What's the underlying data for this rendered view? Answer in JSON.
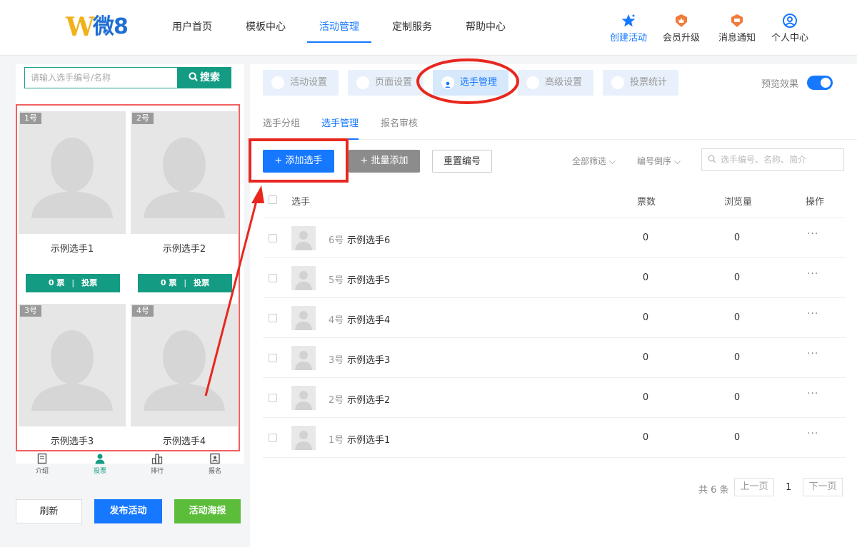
{
  "header": {
    "logo": {
      "letter": "W",
      "text": "微8"
    },
    "nav": [
      {
        "label": "用户首页"
      },
      {
        "label": "模板中心"
      },
      {
        "label": "活动管理",
        "active": true
      },
      {
        "label": "定制服务"
      },
      {
        "label": "帮助中心"
      }
    ],
    "tools": [
      {
        "label": "创建活动",
        "icon": "star-icon",
        "color": "#1677ff"
      },
      {
        "label": "会员升级",
        "icon": "crown-badge-icon",
        "color": "#f07c3a"
      },
      {
        "label": "消息通知",
        "icon": "message-badge-icon",
        "color": "#f07c3a"
      },
      {
        "label": "个人中心",
        "icon": "user-circle-icon",
        "color": "#1677ff"
      }
    ]
  },
  "preview": {
    "search": {
      "placeholder": "请输入选手编号/名称",
      "button": "搜索"
    },
    "contestants": [
      {
        "number": "1号",
        "name": "示例选手1",
        "votes": "0 票",
        "vote_label": "投票"
      },
      {
        "number": "2号",
        "name": "示例选手2",
        "votes": "0 票",
        "vote_label": "投票"
      },
      {
        "number": "3号",
        "name": "示例选手3"
      },
      {
        "number": "4号",
        "name": "示例选手4"
      }
    ],
    "tabbar": [
      {
        "label": "介绍",
        "icon": "document-icon"
      },
      {
        "label": "投票",
        "icon": "person-icon",
        "active": true
      },
      {
        "label": "排行",
        "icon": "bar-chart-icon"
      },
      {
        "label": "报名",
        "icon": "signup-icon"
      }
    ],
    "buttons": {
      "refresh": "刷新",
      "publish": "发布活动",
      "poster": "活动海报"
    }
  },
  "steps": [
    {
      "label": "活动设置",
      "icon": "shield-icon"
    },
    {
      "label": "页面设置",
      "icon": "page-icon"
    },
    {
      "label": "选手管理",
      "icon": "user-icon",
      "active": true
    },
    {
      "label": "高级设置",
      "icon": "sliders-icon"
    },
    {
      "label": "投票统计",
      "icon": "list-icon"
    }
  ],
  "preview_toggle": {
    "label": "预览效果",
    "on": true
  },
  "subtabs": [
    {
      "label": "选手分组"
    },
    {
      "label": "选手管理",
      "active": true
    },
    {
      "label": "报名审核"
    }
  ],
  "actions": {
    "add": "+ 添加选手",
    "batch": "+ 批量添加",
    "reset": "重置编号",
    "filter_all": "全部筛选",
    "sort": "编号倒序",
    "search_placeholder": "选手编号、名称、简介"
  },
  "table": {
    "headers": {
      "player": "选手",
      "votes": "票数",
      "views": "浏览量",
      "ops": "操作"
    },
    "rows": [
      {
        "number": "6号",
        "name": "示例选手6",
        "votes": "0",
        "views": "0",
        "ops": "···"
      },
      {
        "number": "5号",
        "name": "示例选手5",
        "votes": "0",
        "views": "0",
        "ops": "···"
      },
      {
        "number": "4号",
        "name": "示例选手4",
        "votes": "0",
        "views": "0",
        "ops": "···"
      },
      {
        "number": "3号",
        "name": "示例选手3",
        "votes": "0",
        "views": "0",
        "ops": "···"
      },
      {
        "number": "2号",
        "name": "示例选手2",
        "votes": "0",
        "views": "0",
        "ops": "···"
      },
      {
        "number": "1号",
        "name": "示例选手1",
        "votes": "0",
        "views": "0",
        "ops": "···"
      }
    ]
  },
  "pagination": {
    "total": "共 6 条",
    "prev": "上一页",
    "current": "1",
    "next": "下一页"
  },
  "colors": {
    "primary": "#1677ff",
    "teal": "#139c83",
    "green": "#5bbd3a",
    "annotation": "#e8271f"
  }
}
